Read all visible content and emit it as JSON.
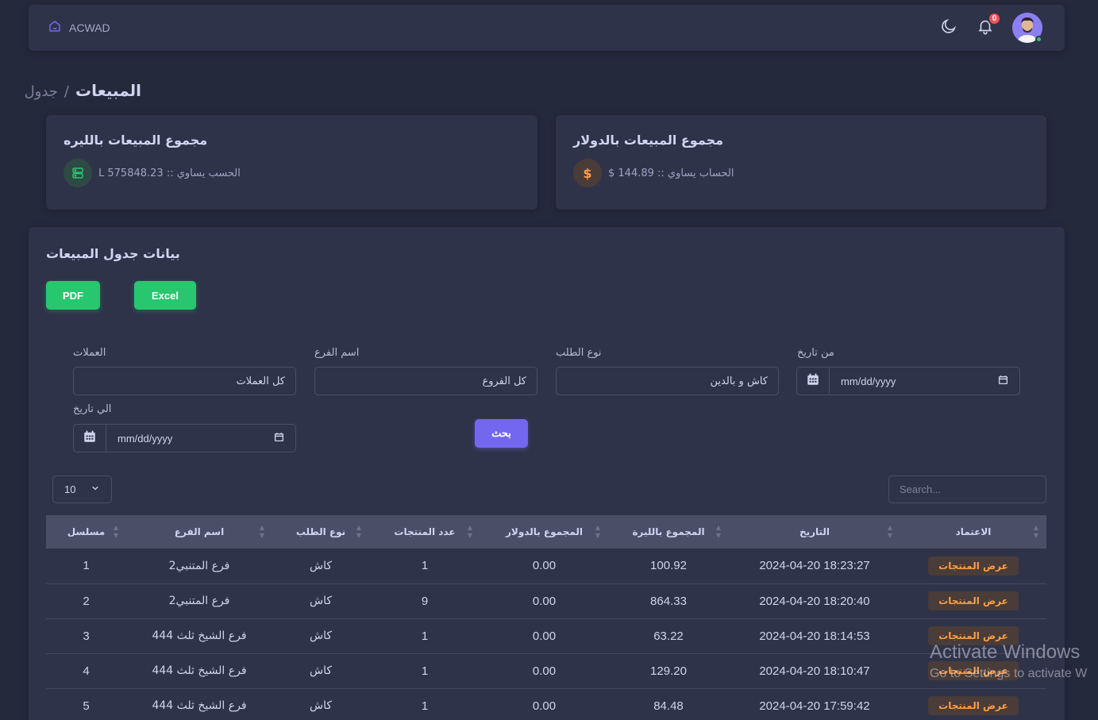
{
  "navbar": {
    "brand": "ACWAD",
    "notification_count": "0"
  },
  "breadcrumb": {
    "current": "المبيعات",
    "separator": "/",
    "parent": "جدول"
  },
  "stats": {
    "usd": {
      "title": "مجموع المبيعات بالدولار",
      "value": "$ الحساب يساوي :: 144.89",
      "icon": "dollar-icon"
    },
    "lira": {
      "title": "مجموع المبيعات بالليره",
      "value": "L الحسب يساوي :: 575848.23",
      "icon": "server-icon"
    }
  },
  "main": {
    "title": "بيانات جدول المبيعات",
    "pdf_label": "PDF",
    "excel_label": "Excel",
    "search_button": "بحث"
  },
  "filters": {
    "from_date": {
      "label": "من تاريخ",
      "placeholder": "mm/dd/yyyy"
    },
    "order_type": {
      "label": "نوع الطلب",
      "value": "كاش و بالدين"
    },
    "branch": {
      "label": "اسم الفرع",
      "value": "كل الفروع"
    },
    "currency": {
      "label": "العملات",
      "value": "كل العملات"
    },
    "to_date": {
      "label": "الي تاريخ",
      "placeholder": "mm/dd/yyyy"
    }
  },
  "table_controls": {
    "page_size": "10",
    "search_placeholder": "Search..."
  },
  "table": {
    "headers": [
      "مسلسل",
      "اسم الفرع",
      "نوع الطلب",
      "عدد المنتجات",
      "المجموع بالدولار",
      "المجموع بالليرة",
      "التاريخ",
      "الاعتماد"
    ],
    "rows": [
      {
        "serial": "1",
        "branch": "فرع المتنبي2",
        "type": "كاش",
        "count": "1",
        "usd": "0.00",
        "lira": "100.92",
        "date": "2024-04-20 18:23:27",
        "action": "عرض المنتجات"
      },
      {
        "serial": "2",
        "branch": "فرع المتنبي2",
        "type": "كاش",
        "count": "9",
        "usd": "0.00",
        "lira": "864.33",
        "date": "2024-04-20 18:20:40",
        "action": "عرض المنتجات"
      },
      {
        "serial": "3",
        "branch": "فرع الشيخ ثلث 444",
        "type": "كاش",
        "count": "1",
        "usd": "0.00",
        "lira": "63.22",
        "date": "2024-04-20 18:14:53",
        "action": "عرض المنتجات"
      },
      {
        "serial": "4",
        "branch": "فرع الشيخ ثلث 444",
        "type": "كاش",
        "count": "1",
        "usd": "0.00",
        "lira": "129.20",
        "date": "2024-04-20 18:10:47",
        "action": "عرض المنتجات"
      },
      {
        "serial": "5",
        "branch": "فرع الشيخ ثلث 444",
        "type": "كاش",
        "count": "1",
        "usd": "0.00",
        "lira": "84.48",
        "date": "2024-04-20 17:59:42",
        "action": "عرض المنتجات"
      }
    ]
  },
  "watermark": {
    "title": "Activate Windows",
    "subtitle": "Go to Settings to activate W"
  },
  "colors": {
    "background": "#25293c",
    "card": "#2f3349",
    "primary": "#7367f0",
    "success": "#28c76f",
    "warning": "#ff9f43",
    "danger": "#ea5455"
  }
}
